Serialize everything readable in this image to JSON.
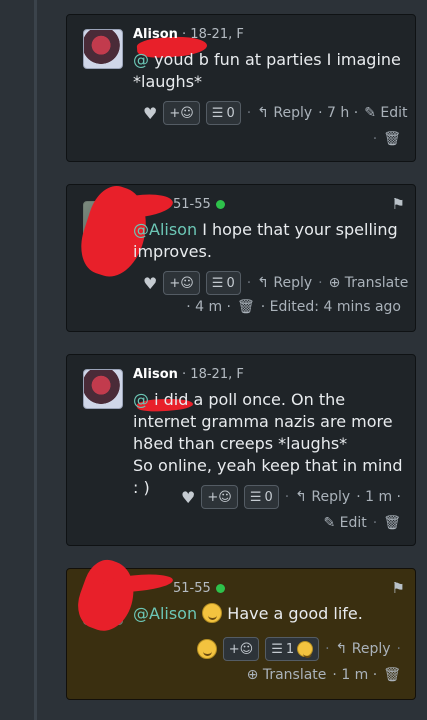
{
  "comments": [
    {
      "author": "Alison",
      "meta": "· 18-21, F",
      "mention": "@",
      "text": " youd b fun at parties I imagine *laughs*",
      "react_label": "+☺",
      "list_count": "0",
      "reply": "Reply",
      "time": "· 7 h ·",
      "edit": "Edit"
    },
    {
      "author_suffix": "51-55",
      "mention": "@Alison",
      "text": " I hope that your spelling improves.",
      "react_label": "+☺",
      "list_count": "0",
      "reply": "Reply",
      "translate": "Translate",
      "time": "· 4 m ·",
      "edited": "· Edited: 4 mins ago"
    },
    {
      "author": "Alison",
      "meta": "· 18-21, F",
      "mention": "@",
      "line1": " i did a poll once. On the",
      "line2": "internet gramma nazis are more",
      "line3": "h8ed than creeps *laughs*",
      "line4": "So online, yeah keep that in mind : )",
      "react_label": "+☺",
      "list_count": "0",
      "reply": "Reply",
      "time": "· 1 m ·",
      "edit": "Edit"
    },
    {
      "author_suffix": "51-55",
      "mention": "@Alison",
      "text": " Have a good life.",
      "react_label": "+☺",
      "list_count": "1",
      "reply": "Reply",
      "translate": "Translate",
      "time": "· 1 m ·"
    }
  ],
  "colors": {
    "accent_mention": "#6cc7b6",
    "online": "#2ec24b",
    "highlight_bg": "#3a2f10"
  },
  "icons": [
    "heart-icon",
    "add-reaction-icon",
    "list-icon",
    "reply-icon",
    "translate-icon",
    "trash-icon",
    "edit-icon",
    "flag-icon"
  ]
}
